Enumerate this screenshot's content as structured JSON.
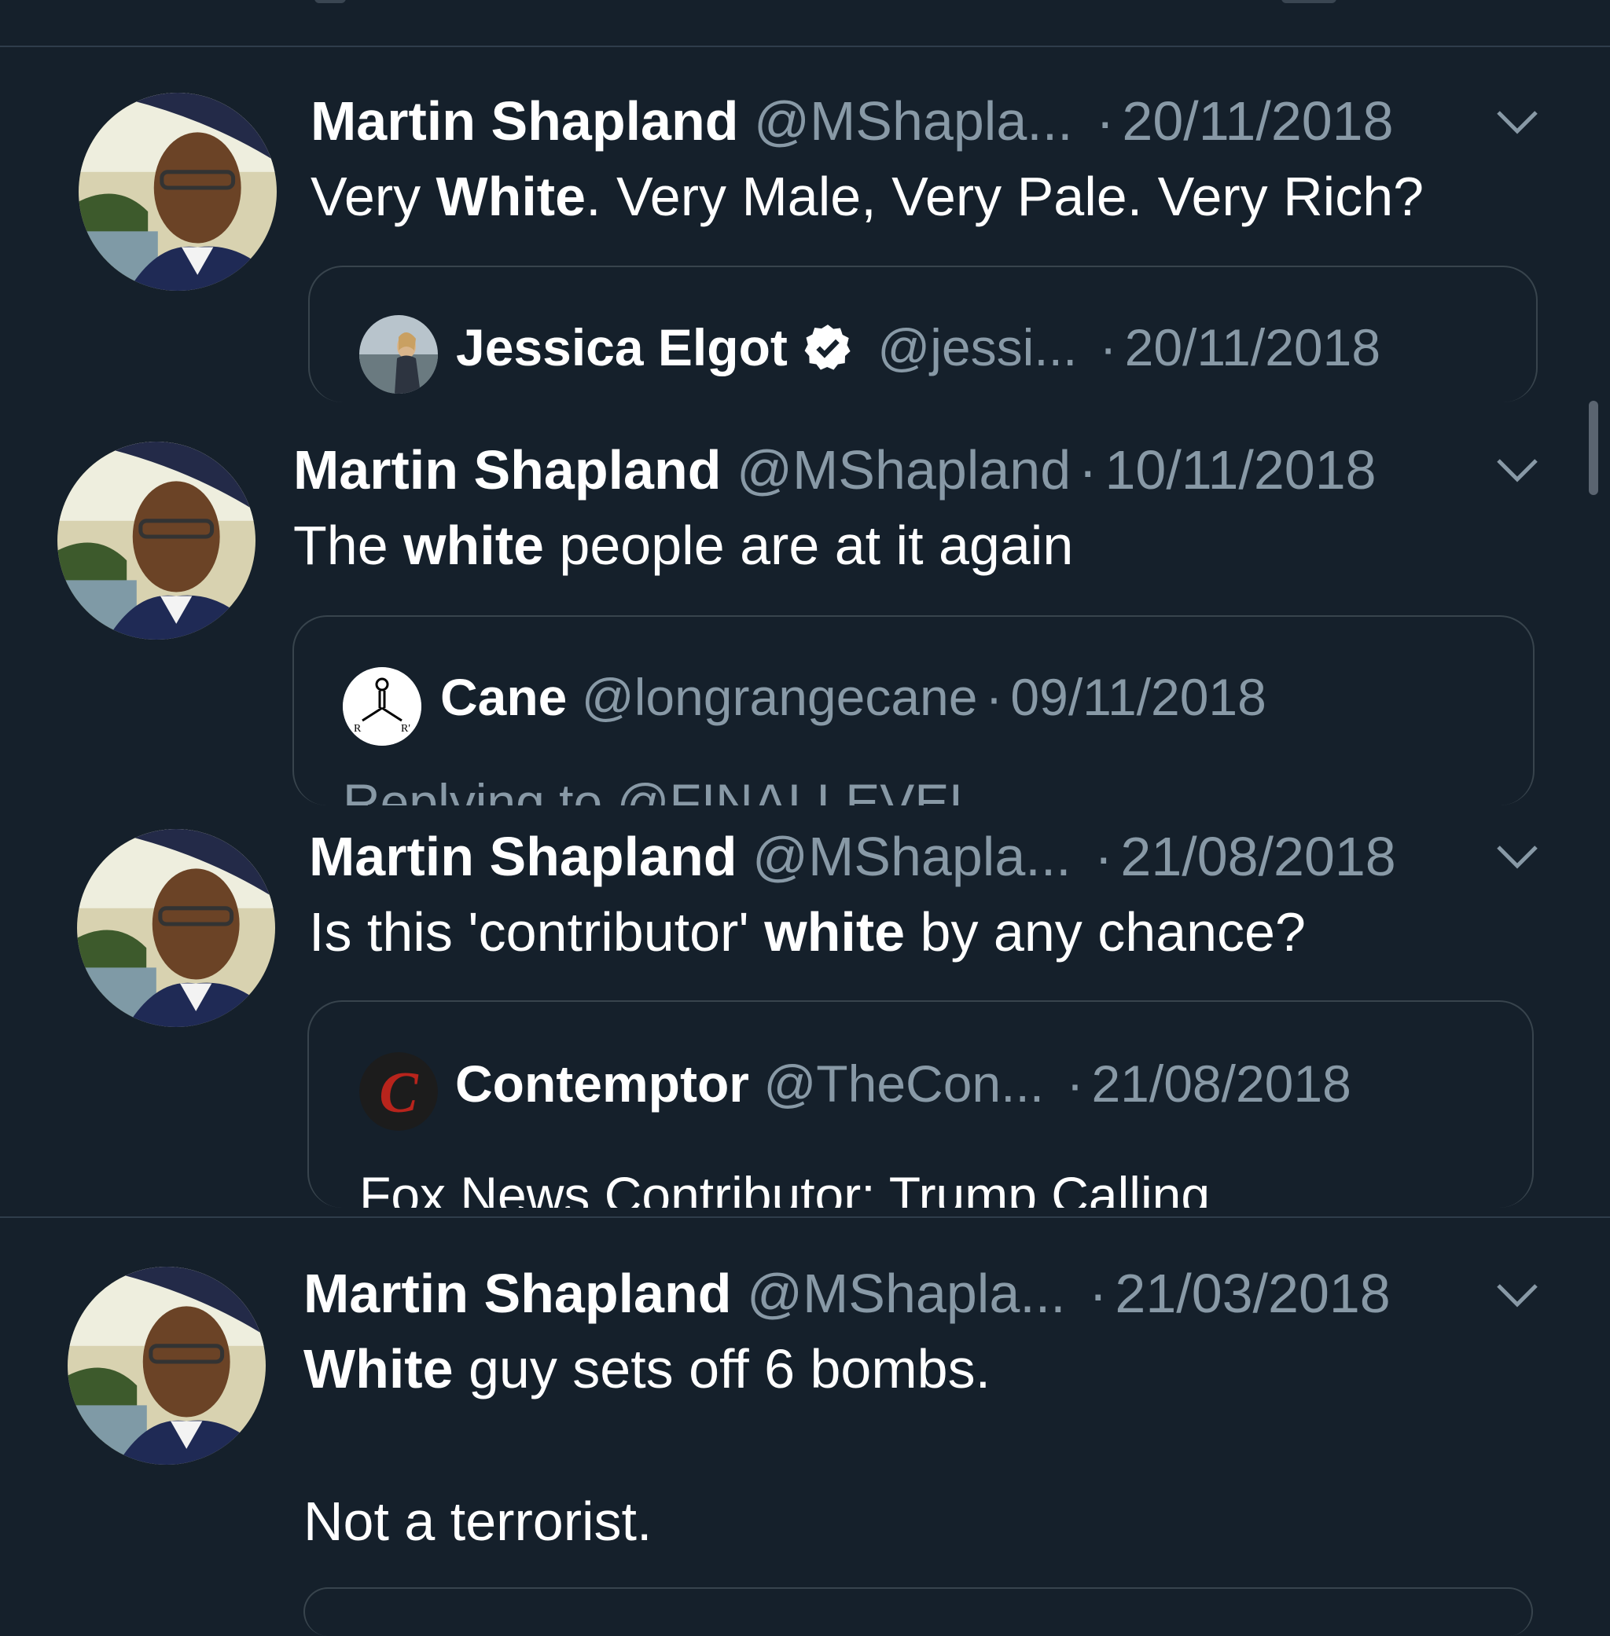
{
  "colors": {
    "background": "#15202b",
    "muted": "#8899a6",
    "border": "#38444d",
    "verified": "#ffffff"
  },
  "tweets": [
    {
      "name": "Martin Shapland",
      "handle": "@MShapla...",
      "date": "20/11/2018",
      "body_parts": [
        "Very ",
        "White",
        ". Very Male, Very Pale. Very Rich?"
      ],
      "quote": {
        "name": "Jessica Elgot",
        "handle": "@jessi...",
        "date": "20/11/2018",
        "verified": true,
        "avatar": "photo"
      }
    },
    {
      "name": "Martin Shapland",
      "handle": "@MShapland",
      "date": "10/11/2018",
      "body_parts": [
        "The ",
        "white",
        " people are at it again"
      ],
      "quote": {
        "name": "Cane",
        "handle": "@longrangecane",
        "date": "09/11/2018",
        "reply_line": "Replying to @FINALLEVEL",
        "avatar": "chemical-structure"
      }
    },
    {
      "name": "Martin Shapland",
      "handle": "@MShapla...",
      "date": "21/08/2018",
      "body_parts": [
        "Is this 'contributor' ",
        "white",
        " by any chance?"
      ],
      "quote": {
        "name": "Contemptor",
        "handle": "@TheCon...",
        "date": "21/08/2018",
        "text": "Fox News Contributor: Trump Calling",
        "avatar": "letter-c-logo"
      }
    },
    {
      "name": "Martin Shapland",
      "handle": "@MShapla...",
      "date": "21/03/2018",
      "body_parts": [
        "White",
        " guy sets off 6 bombs."
      ],
      "body_line2": "Not a terrorist."
    }
  ]
}
